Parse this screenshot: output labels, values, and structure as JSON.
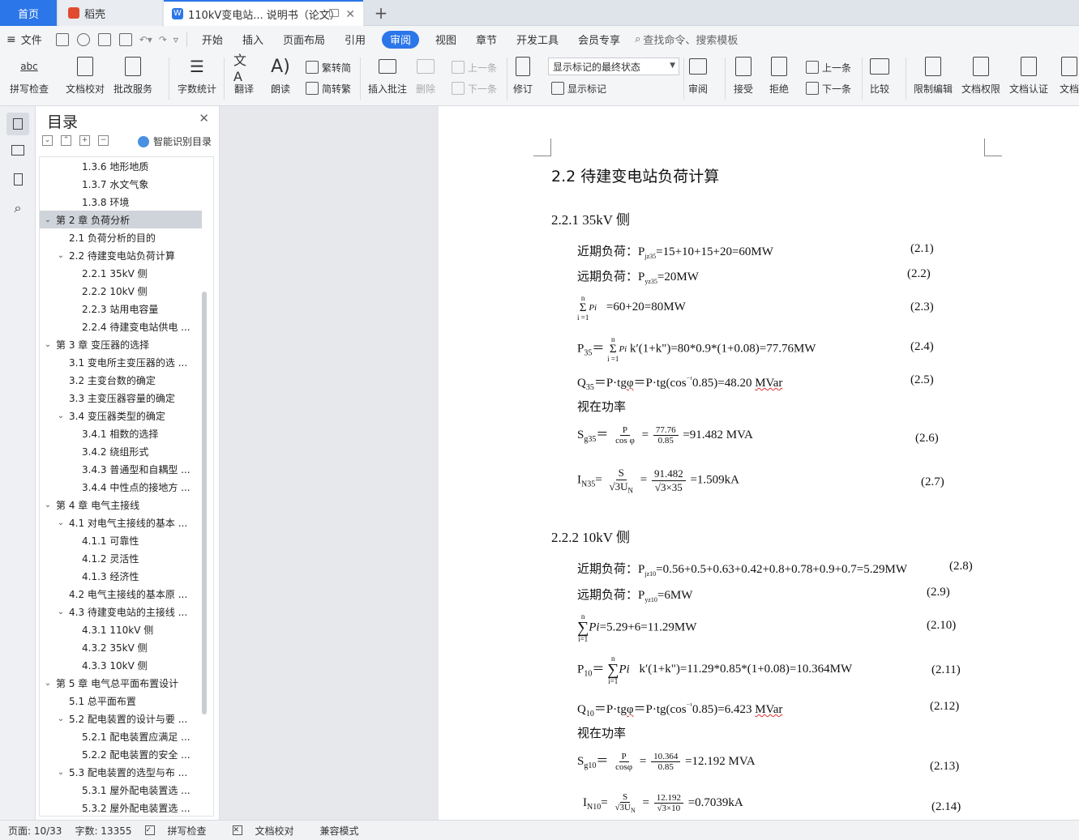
{
  "tabs": {
    "home": "首页",
    "daoke": "稻壳",
    "doc": "110kV变电站... 说明书（论文）"
  },
  "menu": [
    "文件",
    "开始",
    "插入",
    "页面布局",
    "引用",
    "审阅",
    "视图",
    "章节",
    "开发工具",
    "会员专享"
  ],
  "menu_active": "审阅",
  "search_placeholder": "查找命令、搜索模板",
  "ribbon": {
    "spell": "拼写检查",
    "proof": "文档校对",
    "annotate_service": "批改服务",
    "word_count": "字数统计",
    "translate": "翻译",
    "read_aloud": "朗读",
    "trad": "繁转简",
    "simp": "简转繁",
    "insert_comment": "插入批注",
    "delete": "删除",
    "prev": "上一条",
    "next": "下一条",
    "track": "修订",
    "markup_state": "显示标记的最终状态",
    "show_markup": "显示标记",
    "review": "审阅",
    "accept": "接受",
    "reject": "拒绝",
    "prev2": "上一条",
    "next2": "下一条",
    "compare": "比较",
    "restrict": "限制编辑",
    "permission": "文档权限",
    "cert": "文档认证",
    "doc_more": "文档"
  },
  "toc": {
    "title": "目录",
    "smart": "智能识别目录",
    "items": [
      {
        "text": "1.3.6 地形地质",
        "level": 3,
        "chev": ""
      },
      {
        "text": "1.3.7 水文气象",
        "level": 3,
        "chev": ""
      },
      {
        "text": "1.3.8 环境",
        "level": 3,
        "chev": ""
      },
      {
        "text": "第 2 章  负荷分析",
        "level": 1,
        "chev": "⌄",
        "selected": true
      },
      {
        "text": "2.1 负荷分析的目的",
        "level": 2,
        "chev": ""
      },
      {
        "text": "2.2 待建变电站负荷计算",
        "level": 2,
        "chev": "⌄"
      },
      {
        "text": "2.2.1 35kV 侧",
        "level": 3,
        "chev": ""
      },
      {
        "text": "2.2.2 10kV 侧",
        "level": 3,
        "chev": ""
      },
      {
        "text": "2.2.3  站用电容量",
        "level": 3,
        "chev": ""
      },
      {
        "text": "2.2.4  待建变电站供电 ...",
        "level": 3,
        "chev": ""
      },
      {
        "text": "第 3 章  变压器的选择",
        "level": 1,
        "chev": "⌄"
      },
      {
        "text": "3.1 变电所主变压器的选 ...",
        "level": 2,
        "chev": ""
      },
      {
        "text": "3.2 主变台数的确定",
        "level": 2,
        "chev": ""
      },
      {
        "text": "3.3 主变压器容量的确定",
        "level": 2,
        "chev": ""
      },
      {
        "text": "3.4  变压器类型的确定",
        "level": 2,
        "chev": "⌄"
      },
      {
        "text": "3.4.1 相数的选择",
        "level": 3,
        "chev": ""
      },
      {
        "text": "3.4.2  绕组形式",
        "level": 3,
        "chev": ""
      },
      {
        "text": "3.4.3  普通型和自耦型 ...",
        "level": 3,
        "chev": ""
      },
      {
        "text": "3.4.4  中性点的接地方 ...",
        "level": 3,
        "chev": ""
      },
      {
        "text": "第 4 章  电气主接线",
        "level": 1,
        "chev": "⌄"
      },
      {
        "text": "4.1 对电气主接线的基本 ...",
        "level": 2,
        "chev": "⌄"
      },
      {
        "text": "4.1.1 可靠性",
        "level": 3,
        "chev": ""
      },
      {
        "text": "4.1.2 灵活性",
        "level": 3,
        "chev": ""
      },
      {
        "text": "4.1.3 经济性",
        "level": 3,
        "chev": ""
      },
      {
        "text": "4.2 电气主接线的基本原 ...",
        "level": 2,
        "chev": ""
      },
      {
        "text": "4.3 待建变电站的主接线 ...",
        "level": 2,
        "chev": "⌄"
      },
      {
        "text": "4.3.1 110kV 侧",
        "level": 3,
        "chev": ""
      },
      {
        "text": "4.3.2 35kV 侧",
        "level": 3,
        "chev": ""
      },
      {
        "text": "4.3.3 10kV 侧",
        "level": 3,
        "chev": ""
      },
      {
        "text": "第 5 章  电气总平面布置设计",
        "level": 1,
        "chev": "⌄"
      },
      {
        "text": "5.1 总平面布置",
        "level": 2,
        "chev": ""
      },
      {
        "text": "5.2 配电装置的设计与要 ...",
        "level": 2,
        "chev": "⌄"
      },
      {
        "text": "5.2.1  配电装置应满足 ...",
        "level": 3,
        "chev": ""
      },
      {
        "text": "5.2.2  配电装置的安全 ...",
        "level": 3,
        "chev": ""
      },
      {
        "text": "5.3  配电装置的选型与布 ...",
        "level": 2,
        "chev": "⌄"
      },
      {
        "text": "5.3.1  屋外配电装置选 ...",
        "level": 3,
        "chev": ""
      },
      {
        "text": "5.3.2  屋外配电装置选 ...",
        "level": 3,
        "chev": ""
      }
    ]
  },
  "doc": {
    "h_22": "2.2 待建变电站负荷计算",
    "h_221": "2.2.1 35kV 侧",
    "h_222": "2.2.2 10kV 侧",
    "near_label": "近期负荷：P",
    "far_label": "远期负荷：P",
    "sub_j35": "jz35",
    "sub_y35": "yz35",
    "sub_j10": "jz10",
    "sub_y10": "yz10",
    "eq1": "=15+10+15+20=60MW",
    "eq2": "=20MW",
    "eq3": "=60+20=80MW",
    "eq4a": "P",
    "eq4sub": "35",
    "eq4b": "k′(1+k\")=80*0.9*(1+0.08)=77.76MW",
    "eq5a": "Q",
    "eq5sub": "35",
    "eq5b": "＝P·tg",
    "eq5phi": "φ",
    "eq5c": "＝P·tg(cos",
    "eq5d": "0.85)=48.20 ",
    "eq5e": "MVar",
    "apparent": "视在功率",
    "eq6a": "S",
    "eq6sub": "g35",
    "eq6num": "P",
    "eq6den": "cos  φ",
    "eq6num2": "77.76",
    "eq6den2": "0.85",
    "eq6b": "=91.482 MVA",
    "eq7a": "I",
    "eq7sub": "N35",
    "eq7num": "S",
    "eq7den": "√3U",
    "eq7num2": "91.482",
    "eq7den2": "√3×35",
    "eq7b": "=1.509kA",
    "eq8": "=0.56+0.5+0.63+0.42+0.8+0.78+0.9+0.7=5.29MW",
    "eq9": "=6MW",
    "eq10": "=5.29+6=11.29MW",
    "eq11a": "P",
    "eq11sub": "10",
    "eq11b": "k′(1+k\")=11.29*0.85*(1+0.08)=10.364MW",
    "eq12a": "Q",
    "eq12sub": "10",
    "eq12c": "0.85)=6.423 ",
    "eq13a": "S",
    "eq13sub": "g10",
    "eq13den": "cosφ",
    "eq13num2": "10.364",
    "eq13b": "=12.192 MVA",
    "eq14a": "I",
    "eq14sub": "N10",
    "eq14num2": "12.192",
    "eq14den2": "√3×10",
    "eq14b": "=0.7039kA",
    "sig_n": "n",
    "sig_i": "i =1",
    "sig_i2": "i=1",
    "sig_s": "Σ",
    "sig_pi": "Pi",
    "sym_eq": "＝",
    "sym_eq2": "=",
    "sym_inv": "⁻¹",
    "sym_N": "N",
    "sym_sum": "∑",
    "eqnos": [
      "(2.1)",
      "(2.2)",
      "(2.3)",
      "(2.4)",
      "(2.5)",
      "(2.6)",
      "(2.7)",
      "(2.8)",
      "(2.9)",
      "(2.10)",
      "(2.11)",
      "(2.12)",
      "(2.13)",
      "(2.14)"
    ]
  },
  "status": {
    "page": "页面: 10/33",
    "words": "字数: 13355",
    "spell": "拼写检查",
    "proof": "文档校对",
    "compat": "兼容模式"
  },
  "colors": {
    "accent": "#2b76e8",
    "selected_toc": "#cfd4da"
  }
}
